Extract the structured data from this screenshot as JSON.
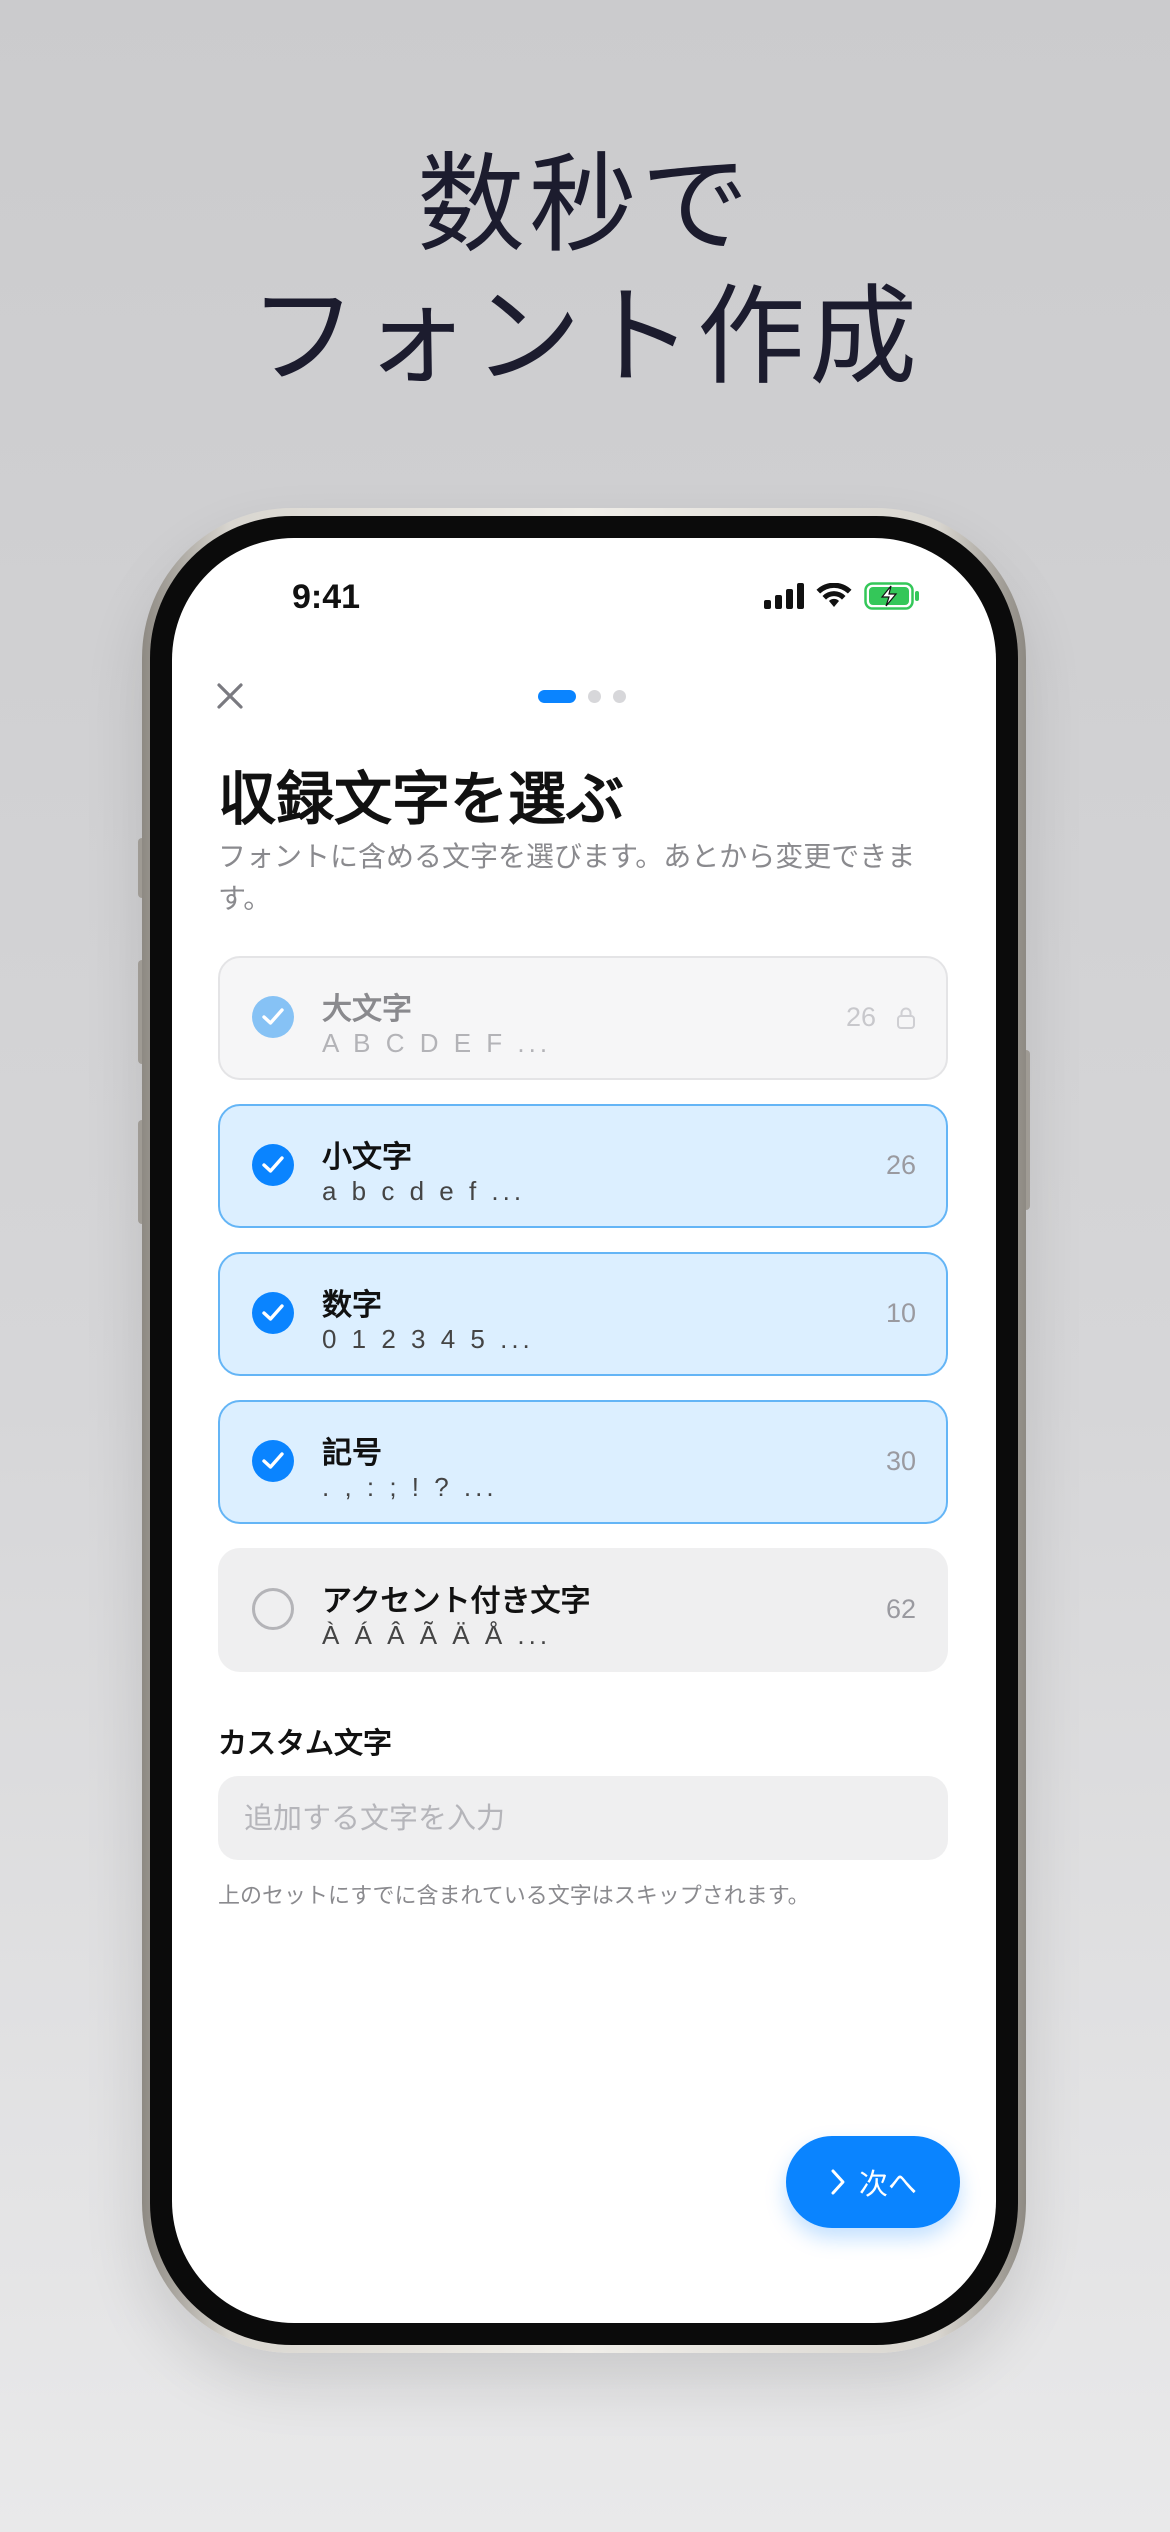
{
  "headline": {
    "line1": "数秒で",
    "line2": "フォント作成"
  },
  "status_bar": {
    "time": "9:41",
    "icons": [
      "signal-icon",
      "wifi-icon",
      "battery-charging-icon"
    ]
  },
  "nav": {
    "close_icon": "close-icon",
    "pager": {
      "total": 3,
      "current": 1
    }
  },
  "page": {
    "title": "収録文字を選ぶ",
    "subtitle": "フォントに含める文字を選びます。あとから変更できます。"
  },
  "options": [
    {
      "label": "大文字",
      "sample": "A B C D E F ...",
      "count": "26",
      "checked": true,
      "locked": true
    },
    {
      "label": "小文字",
      "sample": "a b c d e f ...",
      "count": "26",
      "checked": true,
      "locked": false
    },
    {
      "label": "数字",
      "sample": "0 1 2 3 4 5 ...",
      "count": "10",
      "checked": true,
      "locked": false
    },
    {
      "label": "記号",
      "sample": ". , : ; ! ? ...",
      "count": "30",
      "checked": true,
      "locked": false
    },
    {
      "label": "アクセント付き文字",
      "sample": "À Á Â Ã Ä Å ...",
      "count": "62",
      "checked": false,
      "locked": false
    }
  ],
  "custom": {
    "label": "カスタム文字",
    "placeholder": "追加する文字を入力",
    "value": "",
    "hint": "上のセットにすでに含まれている文字はスキップされます。"
  },
  "next_button": {
    "label": "次へ"
  },
  "colors": {
    "accent": "#0a84ff",
    "selected_bg": "#dcefff",
    "headline": "#1c1c2e"
  }
}
